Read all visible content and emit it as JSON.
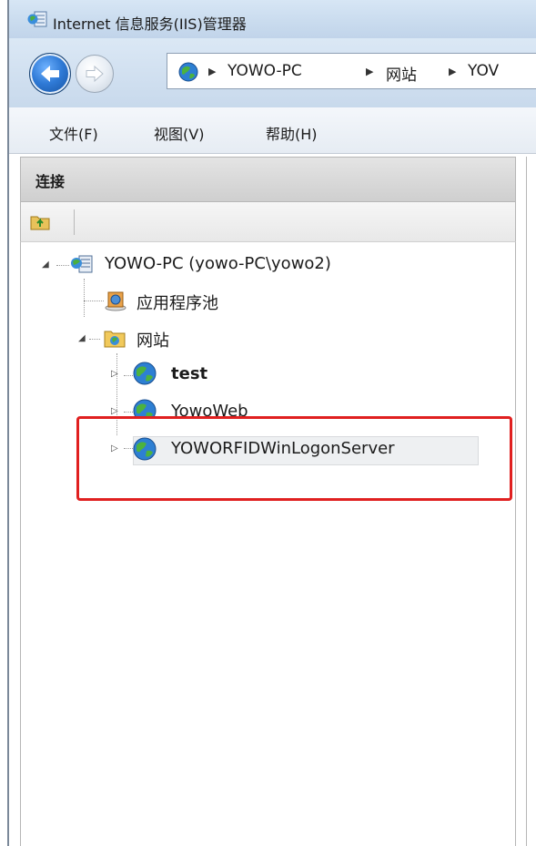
{
  "window": {
    "title": "Internet 信息服务(IIS)管理器"
  },
  "address_bar": {
    "crumbs": [
      "YOWO-PC",
      "网站",
      "YOV"
    ]
  },
  "menu": {
    "items": [
      "文件(F)",
      "视图(V)",
      "帮助(H)"
    ]
  },
  "connections_panel": {
    "title": "连接"
  },
  "tree": {
    "server": "YOWO-PC (yowo-PC\\yowo2)",
    "app_pools": "应用程序池",
    "sites_folder": "网站",
    "sites": [
      "test",
      "YowoWeb",
      "YOWORFIDWinLogonServer"
    ],
    "selected_site": "YOWORFIDWinLogonServer"
  },
  "colors": {
    "highlight_box": "#e02020",
    "titlebar": "#c9dbee"
  },
  "icons": {
    "back": "back-arrow-icon",
    "forward": "forward-arrow-icon",
    "globe": "globe-icon",
    "server": "server-icon",
    "app_pool": "app-pool-icon",
    "folder": "sites-folder-icon",
    "up": "up-level-icon"
  }
}
